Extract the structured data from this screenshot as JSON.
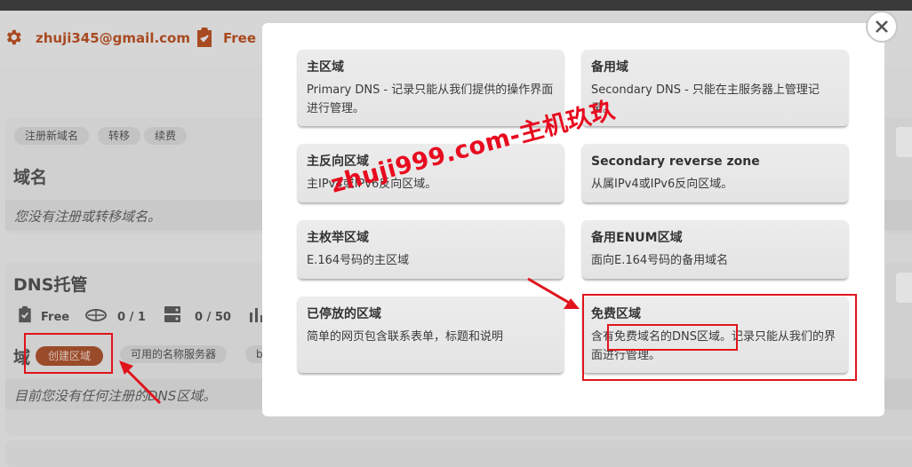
{
  "account": {
    "email": "zhuji345@gmail.com",
    "plan": "Free"
  },
  "domains": {
    "tabs": [
      "注册新域名",
      "转移",
      "续费"
    ],
    "title": "域名",
    "empty_message": "您没有注册或转移域名。"
  },
  "dns_hosting": {
    "title": "DNS托管",
    "stats": [
      {
        "icon": "document-icon",
        "text": "Free"
      },
      {
        "icon": "zone-icon",
        "text": "0 / 1"
      },
      {
        "icon": "server-icon",
        "text": "0 / 50"
      }
    ],
    "section_label": "域",
    "create_button": "创建区域",
    "nameservers_button": "可用的名称服务器",
    "extra_button": "b",
    "empty_message": "目前您没有任何注册的DNS区域。"
  },
  "modal": {
    "options": [
      {
        "title": "主区域",
        "description": "Primary DNS - 记录只能从我们提供的操作界面进行管理。"
      },
      {
        "title": "备用域",
        "description": "Secondary DNS - 只能在主服务器上管理记录。"
      },
      {
        "title": "主反向区域",
        "description": "主IPv4或IPv6反向区域。"
      },
      {
        "title": "Secondary reverse zone",
        "description": "从属IPv4或IPv6反向区域。"
      },
      {
        "title": "主枚举区域",
        "description": "E.164号码的主区域"
      },
      {
        "title": "备用ENUM区域",
        "description": "面向E.164号码的备用域名"
      },
      {
        "title": "已停放的区域",
        "description": "简单的网页包含联系表单，标题和说明"
      },
      {
        "title": "免费区域",
        "description": "含有免费域名的DNS区域。记录只能从我们的界面进行管理。"
      }
    ]
  },
  "watermark": "zhuji999.com-主机玖玖",
  "colors": {
    "accent": "#a84a21",
    "annotation": "#e0141c"
  }
}
